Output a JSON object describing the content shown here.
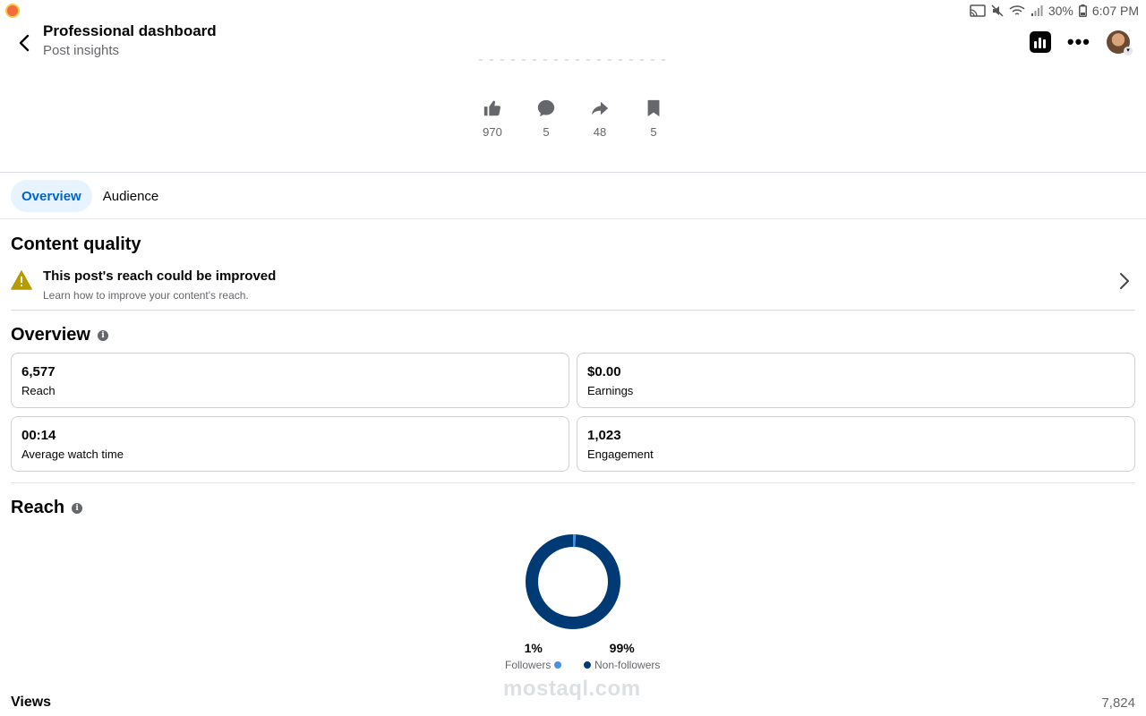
{
  "status_bar": {
    "battery": "30%",
    "time": "6:07 PM",
    "icons": [
      "cast-icon",
      "mute-icon",
      "wifi-icon",
      "signal-icon",
      "battery-icon"
    ]
  },
  "header": {
    "title": "Professional dashboard",
    "subtitle": "Post insights"
  },
  "reactions": [
    {
      "icon": "like-icon",
      "count": "970"
    },
    {
      "icon": "comment-icon",
      "count": "5"
    },
    {
      "icon": "share-icon",
      "count": "48"
    },
    {
      "icon": "bookmark-icon",
      "count": "5"
    }
  ],
  "tabs": [
    {
      "label": "Overview",
      "active": true
    },
    {
      "label": "Audience",
      "active": false
    }
  ],
  "content_quality": {
    "title": "Content quality",
    "notice_title": "This post's reach could be improved",
    "notice_desc": "Learn how to improve your content's reach."
  },
  "overview": {
    "title": "Overview",
    "cards": [
      {
        "value": "6,577",
        "label": "Reach"
      },
      {
        "value": "$0.00",
        "label": "Earnings"
      },
      {
        "value": "00:14",
        "label": "Average watch time"
      },
      {
        "value": "1,023",
        "label": "Engagement"
      }
    ]
  },
  "reach": {
    "title": "Reach",
    "followers_pct": "1%",
    "followers_label": "Followers",
    "nonfollowers_pct": "99%",
    "nonfollowers_label": "Non-followers",
    "followers_fraction": 0.01,
    "colors": {
      "followers": "#4a90e2",
      "nonfollowers": "#003a75"
    }
  },
  "views": {
    "label": "Views",
    "value": "7,824"
  },
  "watermark": "mostaql.com",
  "colors": {
    "accent": "#0064d1",
    "tab_active_bg": "#e7f3ff",
    "warning": "#b59a00"
  }
}
